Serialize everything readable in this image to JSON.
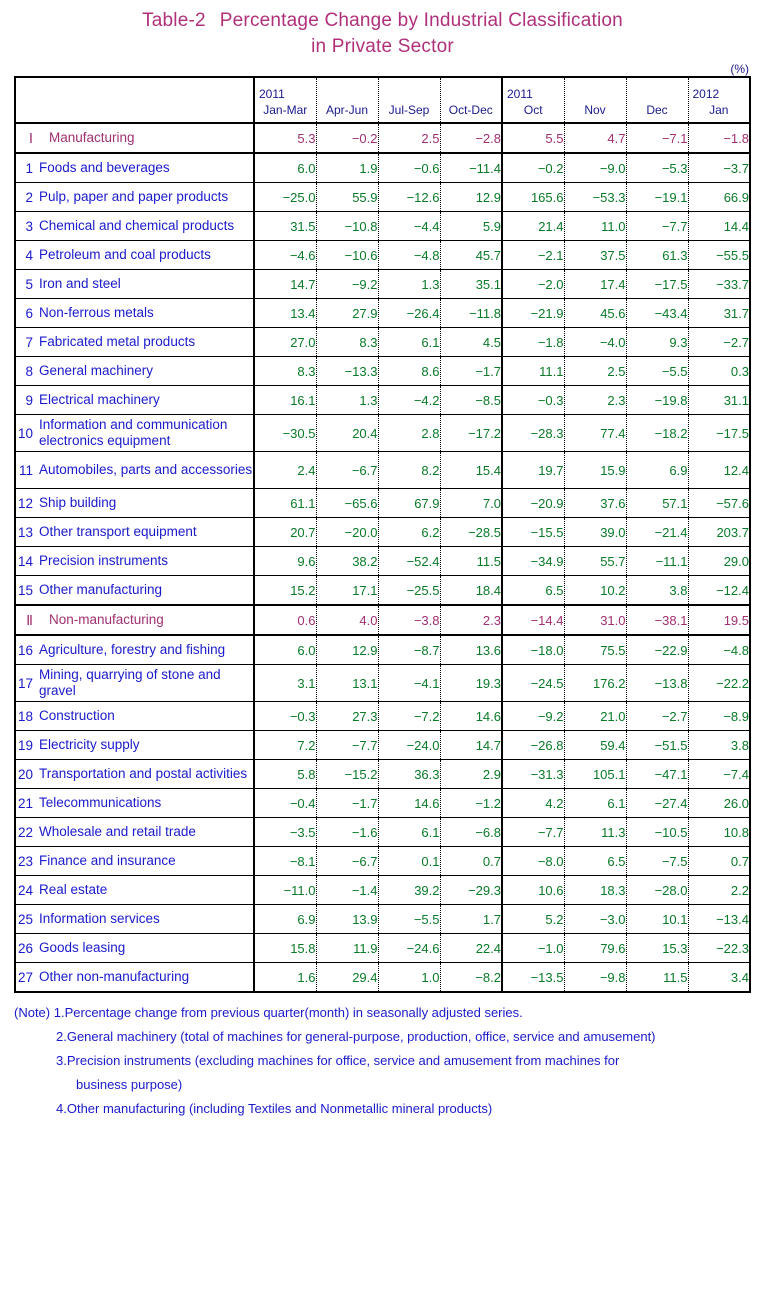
{
  "title": {
    "table_number": "Table-2",
    "line1": "Percentage Change by Industrial Classification",
    "line2": "in Private Sector"
  },
  "unit": "(%)",
  "colors": {
    "title": "#b0307a",
    "section_text": "#a03070",
    "label_text": "#1a1acc",
    "header_text": "#1a1a8c",
    "value_text": "#0a7a28",
    "border": "#000000"
  },
  "header": {
    "label_col": "",
    "columns": [
      {
        "year": "2011",
        "period": "Jan-Mar",
        "group": "quarter"
      },
      {
        "year": "",
        "period": "Apr-Jun",
        "group": "quarter"
      },
      {
        "year": "",
        "period": "Jul-Sep",
        "group": "quarter"
      },
      {
        "year": "",
        "period": "Oct-Dec",
        "group": "quarter"
      },
      {
        "year": "2011",
        "period": "Oct",
        "group": "month"
      },
      {
        "year": "",
        "period": "Nov",
        "group": "month"
      },
      {
        "year": "",
        "period": "Dec",
        "group": "month"
      },
      {
        "year": "2012",
        "period": "Jan",
        "group": "month"
      }
    ]
  },
  "rows": [
    {
      "kind": "section",
      "num": "Ⅰ",
      "label": "Manufacturing",
      "values": [
        "5.3",
        "−0.2",
        "2.5",
        "−2.8",
        "5.5",
        "4.7",
        "−7.1",
        "−1.8"
      ]
    },
    {
      "kind": "item",
      "num": "1",
      "label": "Foods and beverages",
      "values": [
        "6.0",
        "1.9",
        "−0.6",
        "−11.4",
        "−0.2",
        "−9.0",
        "−5.3",
        "−3.7"
      ]
    },
    {
      "kind": "item",
      "num": "2",
      "label": "Pulp, paper and paper products",
      "values": [
        "−25.0",
        "55.9",
        "−12.6",
        "12.9",
        "165.6",
        "−53.3",
        "−19.1",
        "66.9"
      ]
    },
    {
      "kind": "item",
      "num": "3",
      "label": "Chemical and chemical products",
      "values": [
        "31.5",
        "−10.8",
        "−4.4",
        "5.9",
        "21.4",
        "11.0",
        "−7.7",
        "14.4"
      ]
    },
    {
      "kind": "item",
      "num": "4",
      "label": "Petroleum and coal products",
      "values": [
        "−4.6",
        "−10.6",
        "−4.8",
        "45.7",
        "−2.1",
        "37.5",
        "61.3",
        "−55.5"
      ]
    },
    {
      "kind": "item",
      "num": "5",
      "label": "Iron and steel",
      "values": [
        "14.7",
        "−9.2",
        "1.3",
        "35.1",
        "−2.0",
        "17.4",
        "−17.5",
        "−33.7"
      ]
    },
    {
      "kind": "item",
      "num": "6",
      "label": "Non-ferrous metals",
      "values": [
        "13.4",
        "27.9",
        "−26.4",
        "−11.8",
        "−21.9",
        "45.6",
        "−43.4",
        "31.7"
      ]
    },
    {
      "kind": "item",
      "num": "7",
      "label": "Fabricated metal products",
      "values": [
        "27.0",
        "8.3",
        "6.1",
        "4.5",
        "−1.8",
        "−4.0",
        "9.3",
        "−2.7"
      ]
    },
    {
      "kind": "item",
      "num": "8",
      "label": "General machinery",
      "values": [
        "8.3",
        "−13.3",
        "8.6",
        "−1.7",
        "11.1",
        "2.5",
        "−5.5",
        "0.3"
      ]
    },
    {
      "kind": "item",
      "num": "9",
      "label": "Electrical machinery",
      "values": [
        "16.1",
        "1.3",
        "−4.2",
        "−8.5",
        "−0.3",
        "2.3",
        "−19.8",
        "31.1"
      ]
    },
    {
      "kind": "item2",
      "num": "10",
      "label": "Information and communication electronics equipment",
      "values": [
        "−30.5",
        "20.4",
        "2.8",
        "−17.2",
        "−28.3",
        "77.4",
        "−18.2",
        "−17.5"
      ]
    },
    {
      "kind": "item2",
      "num": "11",
      "label": "Automobiles, parts and accessories",
      "values": [
        "2.4",
        "−6.7",
        "8.2",
        "15.4",
        "19.7",
        "15.9",
        "6.9",
        "12.4"
      ]
    },
    {
      "kind": "item",
      "num": "12",
      "label": "Ship building",
      "values": [
        "61.1",
        "−65.6",
        "67.9",
        "7.0",
        "−20.9",
        "37.6",
        "57.1",
        "−57.6"
      ]
    },
    {
      "kind": "item",
      "num": "13",
      "label": "Other transport equipment",
      "values": [
        "20.7",
        "−20.0",
        "6.2",
        "−28.5",
        "−15.5",
        "39.0",
        "−21.4",
        "203.7"
      ]
    },
    {
      "kind": "item",
      "num": "14",
      "label": "Precision instruments",
      "values": [
        "9.6",
        "38.2",
        "−52.4",
        "11.5",
        "−34.9",
        "55.7",
        "−11.1",
        "29.0"
      ]
    },
    {
      "kind": "item",
      "num": "15",
      "label": "Other manufacturing",
      "values": [
        "15.2",
        "17.1",
        "−25.5",
        "18.4",
        "6.5",
        "10.2",
        "3.8",
        "−12.4"
      ]
    },
    {
      "kind": "section2",
      "num": "Ⅱ",
      "label": "Non-manufacturing",
      "values": [
        "0.6",
        "4.0",
        "−3.8",
        "2.3",
        "−14.4",
        "31.0",
        "−38.1",
        "19.5"
      ]
    },
    {
      "kind": "item",
      "num": "16",
      "label": "Agriculture, forestry and fishing",
      "values": [
        "6.0",
        "12.9",
        "−8.7",
        "13.6",
        "−18.0",
        "75.5",
        "−22.9",
        "−4.8"
      ]
    },
    {
      "kind": "item2",
      "num": "17",
      "label": "Mining, quarrying of stone and gravel",
      "values": [
        "3.1",
        "13.1",
        "−4.1",
        "19.3",
        "−24.5",
        "176.2",
        "−13.8",
        "−22.2"
      ]
    },
    {
      "kind": "item",
      "num": "18",
      "label": "Construction",
      "values": [
        "−0.3",
        "27.3",
        "−7.2",
        "14.6",
        "−9.2",
        "21.0",
        "−2.7",
        "−8.9"
      ]
    },
    {
      "kind": "item",
      "num": "19",
      "label": "Electricity supply",
      "values": [
        "7.2",
        "−7.7",
        "−24.0",
        "14.7",
        "−26.8",
        "59.4",
        "−51.5",
        "3.8"
      ]
    },
    {
      "kind": "item",
      "num": "20",
      "label": "Transportation and postal activities",
      "values": [
        "5.8",
        "−15.2",
        "36.3",
        "2.9",
        "−31.3",
        "105.1",
        "−47.1",
        "−7.4"
      ]
    },
    {
      "kind": "item",
      "num": "21",
      "label": "Telecommunications",
      "values": [
        "−0.4",
        "−1.7",
        "14.6",
        "−1.2",
        "4.2",
        "6.1",
        "−27.4",
        "26.0"
      ]
    },
    {
      "kind": "item",
      "num": "22",
      "label": "Wholesale and retail trade",
      "values": [
        "−3.5",
        "−1.6",
        "6.1",
        "−6.8",
        "−7.7",
        "11.3",
        "−10.5",
        "10.8"
      ]
    },
    {
      "kind": "item",
      "num": "23",
      "label": "Finance and insurance",
      "values": [
        "−8.1",
        "−6.7",
        "0.1",
        "0.7",
        "−8.0",
        "6.5",
        "−7.5",
        "0.7"
      ]
    },
    {
      "kind": "item",
      "num": "24",
      "label": "Real estate",
      "values": [
        "−11.0",
        "−1.4",
        "39.2",
        "−29.3",
        "10.6",
        "18.3",
        "−28.0",
        "2.2"
      ]
    },
    {
      "kind": "item",
      "num": "25",
      "label": "Information services",
      "values": [
        "6.9",
        "13.9",
        "−5.5",
        "1.7",
        "5.2",
        "−3.0",
        "10.1",
        "−13.4"
      ]
    },
    {
      "kind": "item",
      "num": "26",
      "label": "Goods leasing",
      "values": [
        "15.8",
        "11.9",
        "−24.6",
        "22.4",
        "−1.0",
        "79.6",
        "15.3",
        "−22.3"
      ]
    },
    {
      "kind": "item",
      "num": "27",
      "label": "Other non-manufacturing",
      "values": [
        "1.6",
        "29.4",
        "1.0",
        "−8.2",
        "−13.5",
        "−9.8",
        "11.5",
        "3.4"
      ]
    }
  ],
  "notes": {
    "prefix": "(Note)",
    "items": [
      "1.Percentage change from previous quarter(month) in seasonally adjusted series.",
      "2.General machinery (total of machines for general-purpose, production, office, service and amusement)",
      "3.Precision instruments (excluding machines for office, service and amusement from machines for",
      "business purpose)",
      "4.Other manufacturing (including Textiles and Nonmetallic mineral products)"
    ]
  },
  "chart_data": {
    "type": "table",
    "title": "Table-2  Percentage Change by Industrial Classification in Private Sector",
    "unit": "%",
    "columns": [
      "2011 Jan-Mar",
      "Apr-Jun",
      "Jul-Sep",
      "Oct-Dec",
      "2011 Oct",
      "Nov",
      "Dec",
      "2012 Jan"
    ],
    "row_labels": [
      "Ⅰ Manufacturing",
      "1 Foods and beverages",
      "2 Pulp, paper and paper products",
      "3 Chemical and chemical products",
      "4 Petroleum and coal products",
      "5 Iron and steel",
      "6 Non-ferrous metals",
      "7 Fabricated metal products",
      "8 General machinery",
      "9 Electrical machinery",
      "10 Information and communication electronics equipment",
      "11 Automobiles, parts and accessories",
      "12 Ship building",
      "13 Other transport equipment",
      "14 Precision instruments",
      "15 Other manufacturing",
      "Ⅱ Non-manufacturing",
      "16 Agriculture, forestry and fishing",
      "17 Mining, quarrying of stone and gravel",
      "18 Construction",
      "19 Electricity supply",
      "20 Transportation and postal activities",
      "21 Telecommunications",
      "22 Wholesale and retail trade",
      "23 Finance and insurance",
      "24 Real estate",
      "25 Information services",
      "26 Goods leasing",
      "27 Other non-manufacturing"
    ],
    "values": [
      [
        5.3,
        -0.2,
        2.5,
        -2.8,
        5.5,
        4.7,
        -7.1,
        -1.8
      ],
      [
        6.0,
        1.9,
        -0.6,
        -11.4,
        -0.2,
        -9.0,
        -5.3,
        -3.7
      ],
      [
        -25.0,
        55.9,
        -12.6,
        12.9,
        165.6,
        -53.3,
        -19.1,
        66.9
      ],
      [
        31.5,
        -10.8,
        -4.4,
        5.9,
        21.4,
        11.0,
        -7.7,
        14.4
      ],
      [
        -4.6,
        -10.6,
        -4.8,
        45.7,
        -2.1,
        37.5,
        61.3,
        -55.5
      ],
      [
        14.7,
        -9.2,
        1.3,
        35.1,
        -2.0,
        17.4,
        -17.5,
        -33.7
      ],
      [
        13.4,
        27.9,
        -26.4,
        -11.8,
        -21.9,
        45.6,
        -43.4,
        31.7
      ],
      [
        27.0,
        8.3,
        6.1,
        4.5,
        -1.8,
        -4.0,
        9.3,
        -2.7
      ],
      [
        8.3,
        -13.3,
        8.6,
        -1.7,
        11.1,
        2.5,
        -5.5,
        0.3
      ],
      [
        16.1,
        1.3,
        -4.2,
        -8.5,
        -0.3,
        2.3,
        -19.8,
        31.1
      ],
      [
        -30.5,
        20.4,
        2.8,
        -17.2,
        -28.3,
        77.4,
        -18.2,
        -17.5
      ],
      [
        2.4,
        -6.7,
        8.2,
        15.4,
        19.7,
        15.9,
        6.9,
        12.4
      ],
      [
        61.1,
        -65.6,
        67.9,
        7.0,
        -20.9,
        37.6,
        57.1,
        -57.6
      ],
      [
        20.7,
        -20.0,
        6.2,
        -28.5,
        -15.5,
        39.0,
        -21.4,
        203.7
      ],
      [
        9.6,
        38.2,
        -52.4,
        11.5,
        -34.9,
        55.7,
        -11.1,
        29.0
      ],
      [
        15.2,
        17.1,
        -25.5,
        18.4,
        6.5,
        10.2,
        3.8,
        -12.4
      ],
      [
        0.6,
        4.0,
        -3.8,
        2.3,
        -14.4,
        31.0,
        -38.1,
        19.5
      ],
      [
        6.0,
        12.9,
        -8.7,
        13.6,
        -18.0,
        75.5,
        -22.9,
        -4.8
      ],
      [
        3.1,
        13.1,
        -4.1,
        19.3,
        -24.5,
        176.2,
        -13.8,
        -22.2
      ],
      [
        -0.3,
        27.3,
        -7.2,
        14.6,
        -9.2,
        21.0,
        -2.7,
        -8.9
      ],
      [
        7.2,
        -7.7,
        -24.0,
        14.7,
        -26.8,
        59.4,
        -51.5,
        3.8
      ],
      [
        5.8,
        -15.2,
        36.3,
        2.9,
        -31.3,
        105.1,
        -47.1,
        -7.4
      ],
      [
        -0.4,
        -1.7,
        14.6,
        -1.2,
        4.2,
        6.1,
        -27.4,
        26.0
      ],
      [
        -3.5,
        -1.6,
        6.1,
        -6.8,
        -7.7,
        11.3,
        -10.5,
        10.8
      ],
      [
        -8.1,
        -6.7,
        0.1,
        0.7,
        -8.0,
        6.5,
        -7.5,
        0.7
      ],
      [
        -11.0,
        -1.4,
        39.2,
        -29.3,
        10.6,
        18.3,
        -28.0,
        2.2
      ],
      [
        6.9,
        13.9,
        -5.5,
        1.7,
        5.2,
        -3.0,
        10.1,
        -13.4
      ],
      [
        15.8,
        11.9,
        -24.6,
        22.4,
        -1.0,
        79.6,
        15.3,
        -22.3
      ],
      [
        1.6,
        29.4,
        1.0,
        -8.2,
        -13.5,
        -9.8,
        11.5,
        3.4
      ]
    ]
  }
}
